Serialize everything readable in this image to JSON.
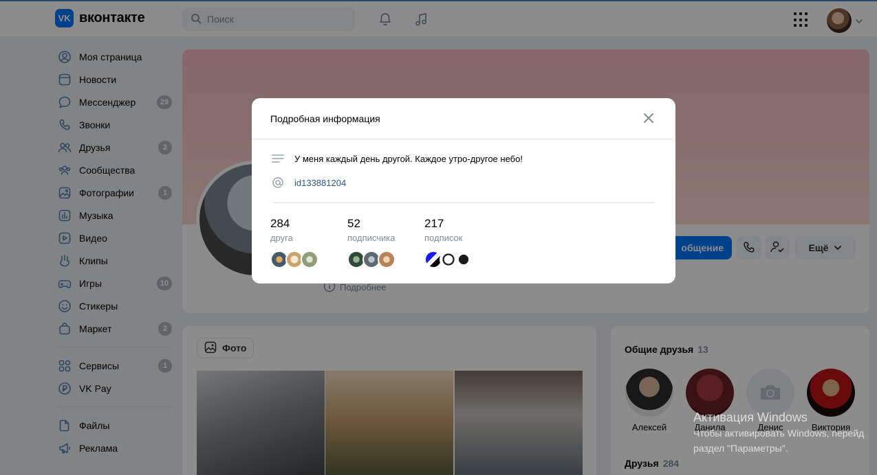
{
  "header": {
    "logo_mark": "VK",
    "logo_text": "вконтакте",
    "search_placeholder": "Поиск"
  },
  "sidebar": {
    "items": [
      {
        "label": "Моя страница",
        "icon": "user-circle-icon",
        "count": ""
      },
      {
        "label": "Новости",
        "icon": "newspaper-icon",
        "count": ""
      },
      {
        "label": "Мессенджер",
        "icon": "chat-bubble-icon",
        "count": "29"
      },
      {
        "label": "Звонки",
        "icon": "phone-icon",
        "count": ""
      },
      {
        "label": "Друзья",
        "icon": "users-icon",
        "count": "2"
      },
      {
        "label": "Сообщества",
        "icon": "communities-icon",
        "count": ""
      },
      {
        "label": "Фотографии",
        "icon": "photo-icon",
        "count": "1"
      },
      {
        "label": "Музыка",
        "icon": "music-bars-icon",
        "count": ""
      },
      {
        "label": "Видео",
        "icon": "video-icon",
        "count": ""
      },
      {
        "label": "Клипы",
        "icon": "clips-icon",
        "count": ""
      },
      {
        "label": "Игры",
        "icon": "gamepad-icon",
        "count": "10"
      },
      {
        "label": "Стикеры",
        "icon": "smile-icon",
        "count": ""
      },
      {
        "label": "Маркет",
        "icon": "bag-icon",
        "count": "2"
      }
    ],
    "items2": [
      {
        "label": "Сервисы",
        "icon": "services-grid-icon",
        "count": "1"
      },
      {
        "label": "VK Pay",
        "icon": "vk-pay-icon",
        "count": ""
      }
    ],
    "items3": [
      {
        "label": "Файлы",
        "icon": "file-icon",
        "count": ""
      },
      {
        "label": "Реклама",
        "icon": "megaphone-icon",
        "count": ""
      }
    ]
  },
  "profile": {
    "more_info_label": "Подробнее",
    "message_button": "общение",
    "more_button": "Ещё"
  },
  "photos": {
    "tab_label": "Фото"
  },
  "common_friends": {
    "title": "Общие друзья",
    "count": "13",
    "friends": [
      "Алексей",
      "Данила",
      "Денис",
      "Виктория"
    ],
    "friends_title": "Друзья",
    "friends_count": "284"
  },
  "modal": {
    "title": "Подробная информация",
    "status": "У меня каждый день другой. Каждое утро-другое небо!",
    "user_id": "id133881204",
    "stats": [
      {
        "number": "284",
        "caption": "друга"
      },
      {
        "number": "52",
        "caption": "подписчика"
      },
      {
        "number": "217",
        "caption": "подписок"
      }
    ]
  },
  "watermark": {
    "title": "Активация Windows",
    "line1": "Чтобы активировать Windows, перейд",
    "line2": "раздел \"Параметры\"."
  },
  "colors": {
    "accent": "#0077ff",
    "link": "#2a5885",
    "badge": "#aeb7c2",
    "muted": "#818c99"
  }
}
